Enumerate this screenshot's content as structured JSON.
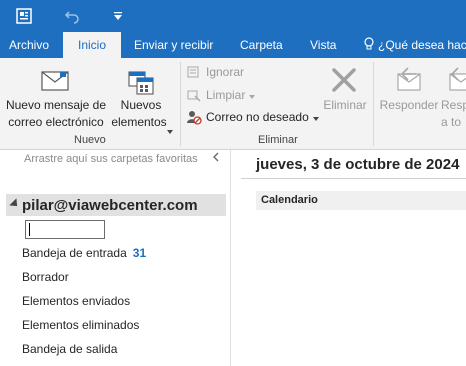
{
  "tabs": {
    "archivo": "Archivo",
    "inicio": "Inicio",
    "enviar_recibir": "Enviar y recibir",
    "carpeta": "Carpeta",
    "vista": "Vista",
    "tell_me": "¿Qué desea hace"
  },
  "ribbon": {
    "nuevo_mensaje_line1": "Nuevo mensaje de",
    "nuevo_mensaje_line2": "correo electrónico",
    "nuevos_line1": "Nuevos",
    "nuevos_line2": "elementos",
    "group_nuevo": "Nuevo",
    "ignorar": "Ignorar",
    "limpiar": "Limpiar",
    "correo_no_deseado": "Correo no deseado",
    "eliminar": "Eliminar",
    "group_eliminar": "Eliminar",
    "responder": "Responder",
    "responder_todos_line1": "Resp",
    "responder_todos_line2": "a to"
  },
  "folder_pane": {
    "favorites_hint": "Arrastre aquí sus carpetas favoritas",
    "account": "pilar@viawebcenter.com",
    "folders": [
      {
        "name": "Bandeja de entrada",
        "count": "31"
      },
      {
        "name": "Borrador",
        "count": ""
      },
      {
        "name": "Elementos enviados",
        "count": ""
      },
      {
        "name": "Elementos eliminados",
        "count": ""
      },
      {
        "name": "Bandeja de salida",
        "count": ""
      }
    ]
  },
  "main": {
    "date": "jueves, 3 de octubre de 2024",
    "calendar_label": "Calendario"
  },
  "colors": {
    "accent": "#1e6fc0",
    "ribbon_bg": "#f3f3f3",
    "selected_row": "#e1e1e1"
  }
}
